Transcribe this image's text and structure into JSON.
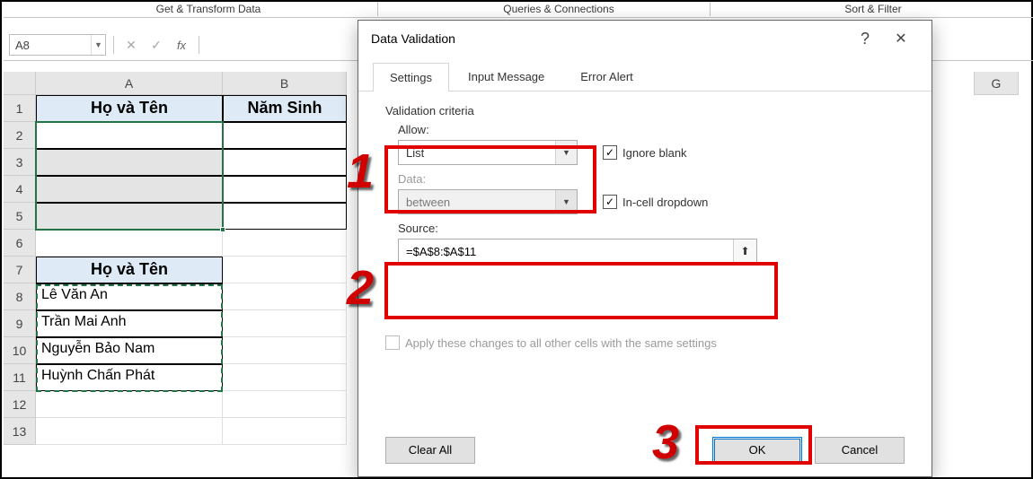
{
  "ribbon": {
    "group1": "Get & Transform Data",
    "group2": "Queries & Connections",
    "group3": "Sort & Filter"
  },
  "nameBox": {
    "value": "A8"
  },
  "formulaBar": {
    "cancel": "✕",
    "enter": "✓",
    "fx": "fx"
  },
  "columns": {
    "A": "A",
    "B": "B",
    "G": "G"
  },
  "rows": [
    "1",
    "2",
    "3",
    "4",
    "5",
    "6",
    "7",
    "8",
    "9",
    "10",
    "11",
    "12",
    "13"
  ],
  "cells": {
    "A1": "Họ và Tên",
    "B1": "Năm Sinh",
    "A7": "Họ và Tên",
    "A8": "Lê Văn An",
    "A9": "Trần Mai Anh",
    "A10": "Nguyễn Bảo Nam",
    "A11": "Huỳnh Chấn Phát"
  },
  "dialog": {
    "title": "Data Validation",
    "help": "?",
    "close": "✕",
    "tabs": {
      "settings": "Settings",
      "input": "Input Message",
      "error": "Error Alert"
    },
    "criteriaLabel": "Validation criteria",
    "allowLabel": "Allow:",
    "allowValue": "List",
    "dataLabel": "Data:",
    "dataValue": "between",
    "sourceLabel": "Source:",
    "sourceValue": "=$A$8:$A$11",
    "ignoreBlank": "Ignore blank",
    "inCellDropdown": "In-cell dropdown",
    "applyAll": "Apply these changes to all other cells with the same settings",
    "clearAll": "Clear All",
    "ok": "OK",
    "cancel": "Cancel",
    "checkMark": "✓",
    "refIcon": "⬆"
  },
  "annotations": {
    "n1": "1",
    "n2": "2",
    "n3": "3"
  }
}
